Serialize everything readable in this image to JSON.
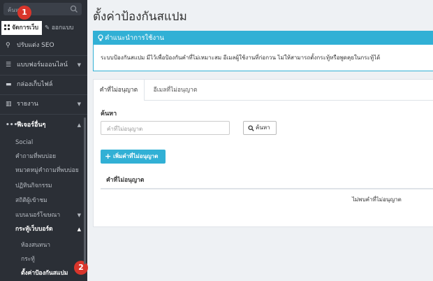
{
  "sidebar": {
    "search_placeholder": "ค้นหา...",
    "tabs": {
      "manage": "จัดการเว็บ",
      "design": "ออกแบบ"
    },
    "items": [
      {
        "label": "ปรับแต่ง SEO",
        "icon": "search-icon"
      },
      {
        "label": "แบบฟอร์มออนไลน์",
        "icon": "list-icon"
      },
      {
        "label": "กล่องเก็บไฟล์",
        "icon": "folder-icon"
      },
      {
        "label": "รายงาน",
        "icon": "chart-icon"
      }
    ],
    "section": {
      "label": "ฟีเจอร์อื่นๆ",
      "icon": "ellipsis-icon"
    },
    "subitems": [
      "Social",
      "คำถามที่พบบ่อย",
      "หมวดหมู่คำถามที่พบบ่อย",
      "ปฏิทินกิจกรรม",
      "สถิติผู้เข้าชม",
      "แบนเนอร์โฆษณา"
    ],
    "webboard": {
      "label": "กระทู้เว็บบอร์ด",
      "items": [
        "ห้องสนทนา",
        "กระทู้",
        "ตั้งค่าป้องกันสแปม"
      ]
    }
  },
  "badges": [
    "1",
    "2"
  ],
  "main": {
    "title": "ตั้งค่าป้องกันสแปม",
    "panel": {
      "heading": "คำแนะนำการใช้งาน",
      "body": "ระบบป้องกันสแปม มีไว้เพื่อป้องกันคำที่ไม่เหมาะสม อีเมลผู้ใช้งานที่ก่อกวน ไม่ให้สามารถตั้งกระทู้หรือพูดคุยในกระทู้ได้"
    },
    "tabs": [
      "คำที่ไม่อนุญาต",
      "อีเมลที่ไม่อนุญาต"
    ],
    "search_label": "ค้นหา",
    "search_placeholder": "คำที่ไม่อนุญาต",
    "search_button": "ค้นหา",
    "add_button": "เพิ่มคำที่ไม่อนุญาต",
    "table_header": "คำที่ไม่อนุญาต",
    "empty_message": "ไม่พบคำที่ไม่อนุญาต"
  },
  "colors": {
    "accent": "#31b0d5",
    "sidebar_bg": "#2b2f36",
    "badge": "#d9352b"
  }
}
